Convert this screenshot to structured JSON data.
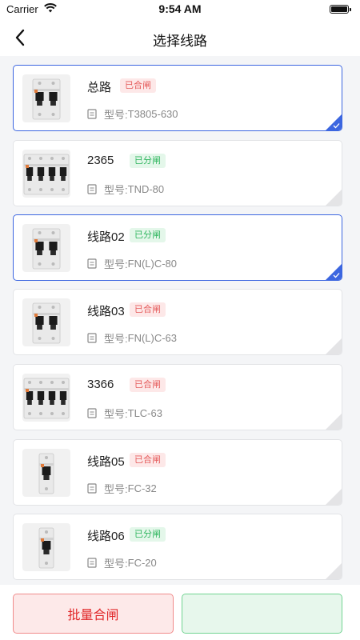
{
  "status_bar": {
    "carrier": "Carrier",
    "time": "9:54 AM"
  },
  "nav": {
    "title": "选择线路"
  },
  "items": [
    {
      "name": "总路",
      "status": "已合闸",
      "status_type": "closed",
      "model_label": "型号:",
      "model": "T3805-630",
      "selected": true,
      "device": "2pole-breaker"
    },
    {
      "name": "2365",
      "status": "已分闸",
      "status_type": "open",
      "model_label": "型号:",
      "model": "TND-80",
      "selected": false,
      "device": "4pole-breaker"
    },
    {
      "name": "线路02",
      "status": "已分闸",
      "status_type": "open",
      "model_label": "型号:",
      "model": "FN(L)C-80",
      "selected": true,
      "device": "2pole-breaker"
    },
    {
      "name": "线路03",
      "status": "已合闸",
      "status_type": "closed",
      "model_label": "型号:",
      "model": "FN(L)C-63",
      "selected": false,
      "device": "2pole-breaker"
    },
    {
      "name": "3366",
      "status": "已合闸",
      "status_type": "closed",
      "model_label": "型号:",
      "model": "TLC-63",
      "selected": false,
      "device": "4pole-breaker"
    },
    {
      "name": "线路05",
      "status": "已合闸",
      "status_type": "closed",
      "model_label": "型号:",
      "model": "FC-32",
      "selected": false,
      "device": "1pole-breaker"
    },
    {
      "name": "线路06",
      "status": "已分闸",
      "status_type": "open",
      "model_label": "型号:",
      "model": "FC-20",
      "selected": false,
      "device": "1pole-breaker"
    }
  ],
  "footer": {
    "batch_close_label": "批量合闸",
    "batch_open_label": ""
  },
  "colors": {
    "selected_border": "#3c66e0",
    "closed_badge": "#e55b5b",
    "open_badge": "#2fb55e",
    "danger_button": "#e1292b"
  }
}
